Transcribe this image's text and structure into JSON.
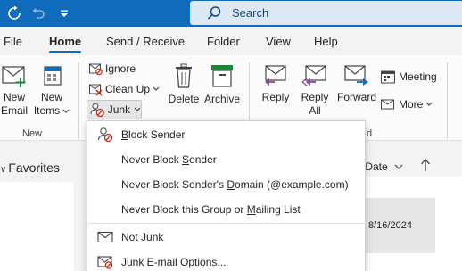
{
  "colors": {
    "accent": "#0f6cbd",
    "ribbon_bg": "#fbfbfb",
    "menu_bg": "#f3f3f3"
  },
  "titlebar": {
    "sync_icon": "sync-icon",
    "undo_icon": "undo-icon",
    "customize_icon": "customize-quick-access-icon",
    "search_placeholder": "Search"
  },
  "menu": {
    "tabs": [
      "File",
      "Home",
      "Send / Receive",
      "Folder",
      "View",
      "Help"
    ],
    "active": "Home"
  },
  "ribbon": {
    "new_email": [
      "New",
      "Email"
    ],
    "new_items": [
      "New",
      "Items"
    ],
    "group_new": "New",
    "ignore": "Ignore",
    "clean_up": "Clean Up",
    "junk": "Junk",
    "delete": "Delete",
    "archive": "Archive",
    "reply": "Reply",
    "reply_all": [
      "Reply",
      "All"
    ],
    "forward": "Forward",
    "meeting": "Meeting",
    "more": "More",
    "group_respond_tail": "d"
  },
  "junk_menu": {
    "items": [
      {
        "pre": "",
        "ul": "B",
        "post": "lock Sender",
        "icon": "block-sender-icon"
      },
      {
        "pre": "Never Block ",
        "ul": "S",
        "post": "ender",
        "icon": ""
      },
      {
        "pre": "Never Block Sender's ",
        "ul": "D",
        "post": "omain (@example.com)",
        "icon": ""
      },
      {
        "pre": "Never Block this Group or ",
        "ul": "M",
        "post": "ailing List",
        "icon": ""
      },
      {
        "pre": "",
        "ul": "N",
        "post": "ot Junk",
        "icon": "not-junk-icon"
      },
      {
        "pre": "Junk E-mail ",
        "ul": "O",
        "post": "ptions...",
        "icon": "junk-options-icon"
      }
    ]
  },
  "body": {
    "favorites": "Favorites",
    "sort_label": "y Date",
    "mail_date": "8/16/2024"
  }
}
